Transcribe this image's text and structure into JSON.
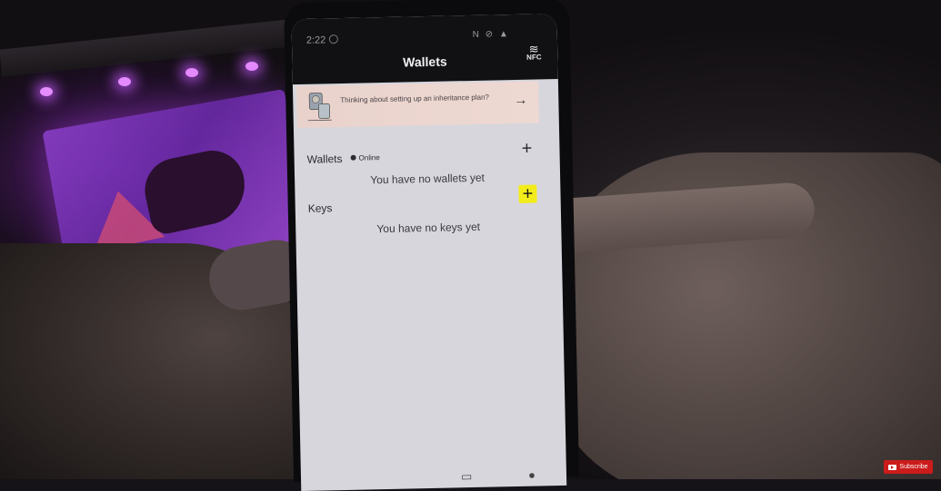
{
  "statusbar": {
    "time": "2:22",
    "icons": "N ⊘ ▲"
  },
  "header": {
    "title": "Wallets",
    "nfc_label": "NFC",
    "nfc_icon": "nfc-icon"
  },
  "banner": {
    "text": "Thinking about setting up an inheritance plan?",
    "arrow_icon": "arrow-right-icon",
    "background": "#e9d2cc"
  },
  "wallets": {
    "label": "Wallets",
    "status": "Online",
    "empty_message": "You have no wallets yet",
    "add_icon": "plus-icon"
  },
  "keys": {
    "label": "Keys",
    "empty_message": "You have no keys yet",
    "add_icon": "plus-icon",
    "add_highlight_color": "#f2ec1a"
  },
  "overlay": {
    "subscribe_label": "Subscribe",
    "subscribe_color": "#cc1b1b"
  }
}
